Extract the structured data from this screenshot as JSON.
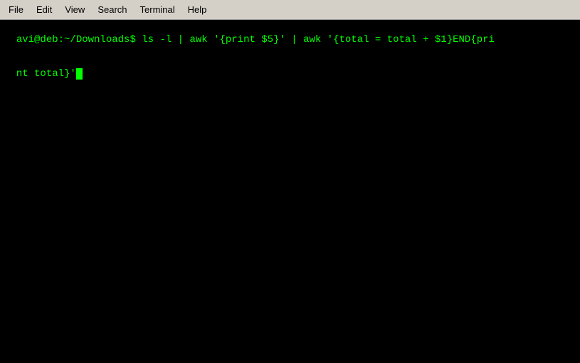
{
  "menubar": {
    "items": [
      {
        "id": "file",
        "label": "File"
      },
      {
        "id": "edit",
        "label": "Edit"
      },
      {
        "id": "view",
        "label": "View"
      },
      {
        "id": "search",
        "label": "Search"
      },
      {
        "id": "terminal",
        "label": "Terminal"
      },
      {
        "id": "help",
        "label": "Help"
      }
    ]
  },
  "terminal": {
    "line1": "avi@deb:~/Downloads$ ls -l | awk '{print $5}' | awk '{total = total + $1}END{pri",
    "line2": "nt total}'"
  },
  "colors": {
    "terminal_bg": "#000000",
    "terminal_fg": "#00ff00",
    "menubar_bg": "#d4d0c8"
  }
}
